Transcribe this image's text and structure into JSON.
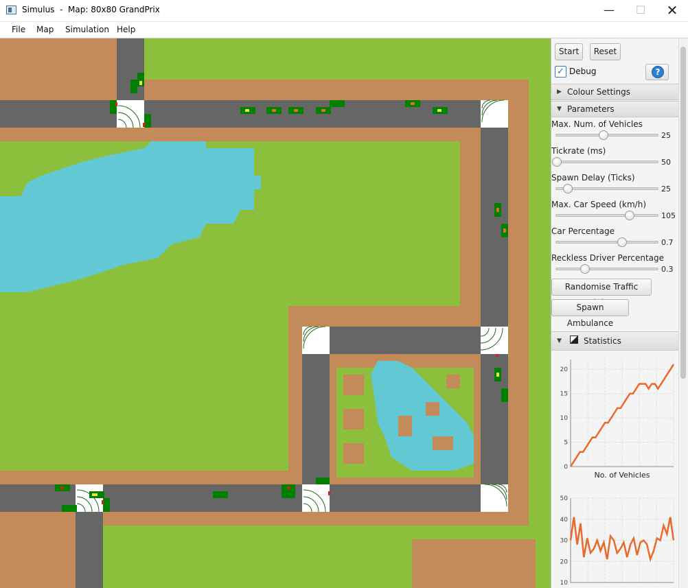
{
  "window": {
    "title": "Simulus  -  Map: 80x80 GrandPrix",
    "minimize": "—",
    "maximize": "☐",
    "close": "✕"
  },
  "menu": [
    "File",
    "Map",
    "Simulation",
    "Help"
  ],
  "controls": {
    "start": "Start",
    "reset": "Reset",
    "debug_label": "Debug",
    "debug_checked": true,
    "help": "?"
  },
  "sections": {
    "colour": "Colour Settings",
    "parameters": "Parameters",
    "statistics": "Statistics"
  },
  "parameters": [
    {
      "label": "Max. Num. of Vehicles",
      "value": "25",
      "fraction": 0.5
    },
    {
      "label": "Tickrate (ms)",
      "value": "50",
      "fraction": 0.0
    },
    {
      "label": "Spawn Delay (Ticks)",
      "value": "25",
      "fraction": 0.12
    },
    {
      "label": "Max. Car Speed (km/h)",
      "value": "105",
      "fraction": 0.78
    },
    {
      "label": "Car Percentage",
      "value": "0.7",
      "fraction": 0.7
    },
    {
      "label": "Reckless Driver Percentage",
      "value": "0.3",
      "fraction": 0.3
    }
  ],
  "actions": {
    "randomise": "Randomise Traffic Lights",
    "ambulance": "Spawn Ambulance"
  },
  "colors": {
    "grass": "#8cc03c",
    "dirt": "#c48b5a",
    "road": "#666666",
    "water": "#62c8d4",
    "car": "#007f00",
    "accent": "#e8692a"
  },
  "chart_data": [
    {
      "type": "line",
      "xlabel": "No. of Vehicles",
      "ylabel": "",
      "ylim": [
        0,
        22
      ],
      "yticks": [
        "0",
        "5",
        "10",
        "15",
        "20"
      ],
      "grid": true,
      "series": [
        {
          "values": [
            0,
            1,
            2,
            3,
            3,
            4,
            5,
            6,
            6,
            7,
            8,
            9,
            9,
            10,
            11,
            12,
            12,
            13,
            14,
            15,
            15,
            16,
            17,
            17,
            17,
            16,
            17,
            17,
            16,
            17,
            18,
            19,
            20,
            21
          ]
        }
      ]
    },
    {
      "type": "line",
      "xlabel": "",
      "ylabel": "",
      "ylim": [
        10,
        50
      ],
      "yticks": [
        "10",
        "20",
        "30",
        "40",
        "50"
      ],
      "grid": true,
      "series": [
        {
          "values": [
            30,
            41,
            28,
            38,
            22,
            31,
            24,
            26,
            30,
            25,
            29,
            21,
            32,
            30,
            24,
            26,
            29,
            22,
            28,
            31,
            23,
            29,
            30,
            28,
            21,
            25,
            31,
            30,
            37,
            33,
            41,
            30
          ]
        }
      ]
    }
  ]
}
